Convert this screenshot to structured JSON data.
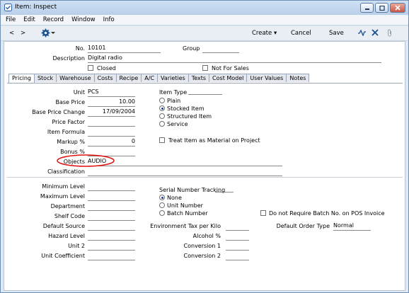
{
  "window": {
    "title": "Item: Inspect"
  },
  "menu": [
    "File",
    "Edit",
    "Record",
    "Window",
    "Info"
  ],
  "toolbar": {
    "create": "Create",
    "cancel": "Cancel",
    "save": "Save"
  },
  "header": {
    "no_label": "No.",
    "no_value": "10101",
    "group_label": "Group",
    "group_value": "",
    "description_label": "Description",
    "description_value": "Digital radio",
    "closed_label": "Closed",
    "not_for_sales_label": "Not For Sales"
  },
  "tabs": [
    "Pricing",
    "Stock",
    "Warehouse",
    "Costs",
    "Recipe",
    "A/C",
    "Varieties",
    "Texts",
    "Cost Model",
    "User Values",
    "Notes"
  ],
  "active_tab": "Pricing",
  "pricing": {
    "unit_label": "Unit",
    "unit_value": "PCS",
    "base_price_label": "Base Price",
    "base_price_value": "10.00",
    "base_price_change_label": "Base Price Change",
    "base_price_change_value": "17/09/2004",
    "price_factor_label": "Price Factor",
    "price_factor_value": "",
    "item_formula_label": "Item Formula",
    "item_formula_value": "",
    "markup_label": "Markup %",
    "markup_value": "0",
    "bonus_label": "Bonus %",
    "bonus_value": "",
    "objects_label": "Objects",
    "objects_value": "AUDIO",
    "classification_label": "Classification",
    "classification_value": "",
    "item_type_label": "Item Type",
    "item_types": [
      "Plain",
      "Stocked Item",
      "Structured Item",
      "Service"
    ],
    "item_type_selected": "Stocked Item",
    "treat_item_label": "Treat Item as Material on Project"
  },
  "stock": {
    "minimum_level_label": "Minimum Level",
    "maximum_level_label": "Maximum Level",
    "department_label": "Department",
    "shelf_code_label": "Shelf Code",
    "default_source_label": "Default Source",
    "hazard_level_label": "Hazard Level",
    "unit2_label": "Unit 2",
    "unit_coefficient_label": "Unit Coefficient",
    "serial_tracking_label": "Serial Number Tracking",
    "serial_options": [
      "None",
      "Unit Number",
      "Batch Number"
    ],
    "serial_selected": "None",
    "do_not_require_label": "Do not Require Batch No. on POS Invoice",
    "env_tax_label": "Environment Tax per Kilo",
    "alcohol_label": "Alcohol %",
    "conversion1_label": "Conversion 1",
    "conversion2_label": "Conversion 2",
    "default_order_type_label": "Default Order Type",
    "default_order_type_value": "Normal"
  },
  "colors": {
    "highlight_oval": "#e01010",
    "radio_dot": "#1a3f8a"
  }
}
